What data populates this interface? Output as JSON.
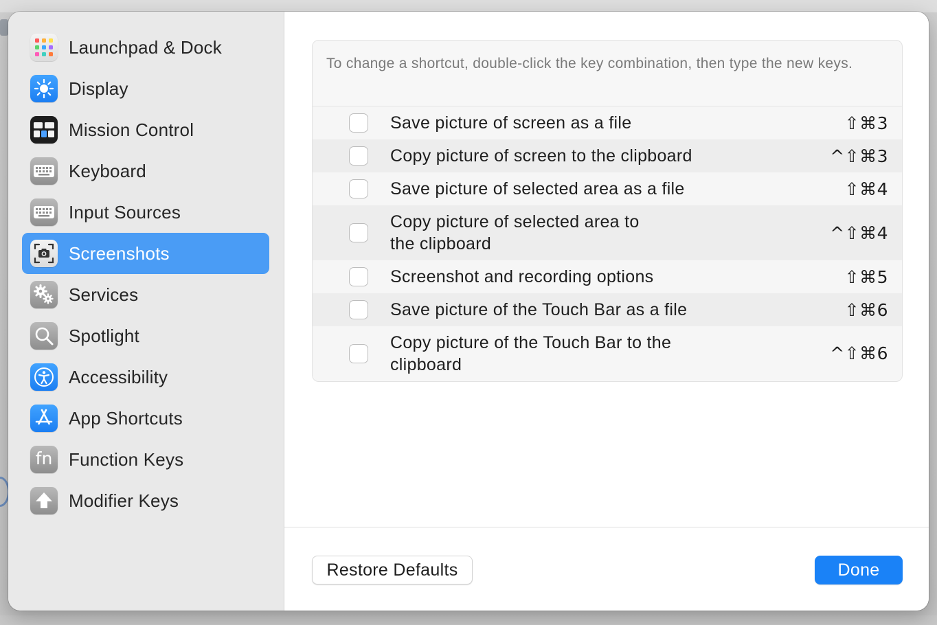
{
  "sidebar": {
    "selected_color": "#4a9cf5",
    "items": [
      {
        "label": "Launchpad & Dock",
        "icon": "launchpad-dock-icon"
      },
      {
        "label": "Display",
        "icon": "display-icon"
      },
      {
        "label": "Mission Control",
        "icon": "mission-control-icon"
      },
      {
        "label": "Keyboard",
        "icon": "keyboard-icon"
      },
      {
        "label": "Input Sources",
        "icon": "input-sources-icon"
      },
      {
        "label": "Screenshots",
        "icon": "screenshots-icon",
        "selected": true
      },
      {
        "label": "Services",
        "icon": "services-gear-icon"
      },
      {
        "label": "Spotlight",
        "icon": "spotlight-magnifier-icon"
      },
      {
        "label": "Accessibility",
        "icon": "accessibility-icon"
      },
      {
        "label": "App Shortcuts",
        "icon": "app-shortcuts-icon"
      },
      {
        "label": "Function Keys",
        "icon": "function-keys-icon"
      },
      {
        "label": "Modifier Keys",
        "icon": "modifier-keys-icon"
      }
    ],
    "fn_glyph": "fn"
  },
  "main": {
    "hint": "To change a shortcut, double-click the key combination, then type the new keys.",
    "shortcuts": [
      {
        "label": "Save picture of screen as a file",
        "keys": "⇧⌘3",
        "checked": false
      },
      {
        "label": "Copy picture of screen to the clipboard",
        "keys": "^⇧⌘3",
        "checked": false
      },
      {
        "label": "Save picture of selected area as a file",
        "keys": "⇧⌘4",
        "checked": false
      },
      {
        "label": "Copy picture of selected area to the clipboard",
        "keys": "^⇧⌘4",
        "checked": false
      },
      {
        "label": "Screenshot and recording options",
        "keys": "⇧⌘5",
        "checked": false
      },
      {
        "label": "Save picture of the Touch Bar as a file",
        "keys": "⇧⌘6",
        "checked": false
      },
      {
        "label": "Copy picture of the Touch Bar to the clipboard",
        "keys": "^⇧⌘6",
        "checked": false
      }
    ]
  },
  "footer": {
    "restore_label": "Restore Defaults",
    "done_label": "Done",
    "accent_color": "#1a82f7"
  }
}
